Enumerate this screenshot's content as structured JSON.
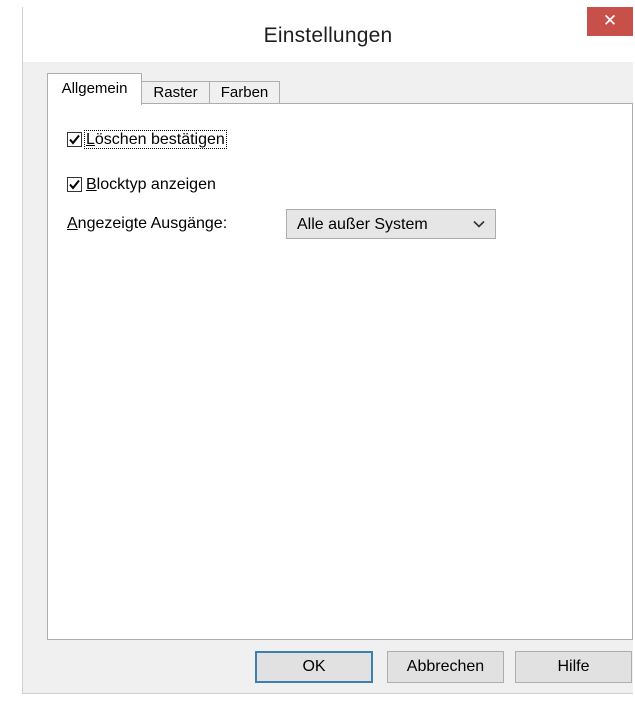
{
  "window": {
    "title": "Einstellungen",
    "close_glyph": "✕"
  },
  "tabs": [
    {
      "label": "Allgemein",
      "active": true
    },
    {
      "label": "Raster",
      "active": false
    },
    {
      "label": "Farben",
      "active": false
    }
  ],
  "general": {
    "confirm_delete": {
      "label_accel": "L",
      "label_rest": "öschen bestätigen",
      "checked": true
    },
    "show_blocktype": {
      "label_accel": "B",
      "label_rest": "locktyp anzeigen",
      "checked": true
    },
    "outputs_label_accel": "A",
    "outputs_label_rest": "ngezeigte Ausgänge:",
    "outputs_value": "Alle außer System"
  },
  "buttons": {
    "ok": "OK",
    "cancel": "Abbrechen",
    "help": "Hilfe"
  },
  "icons": {
    "close": "close-icon",
    "check": "checkmark-icon",
    "dropdown": "chevron-down-icon"
  },
  "colors": {
    "close_button": "#c7504b",
    "default_button_border": "#3c7fb1",
    "dialog_background": "#f0f0f0"
  }
}
